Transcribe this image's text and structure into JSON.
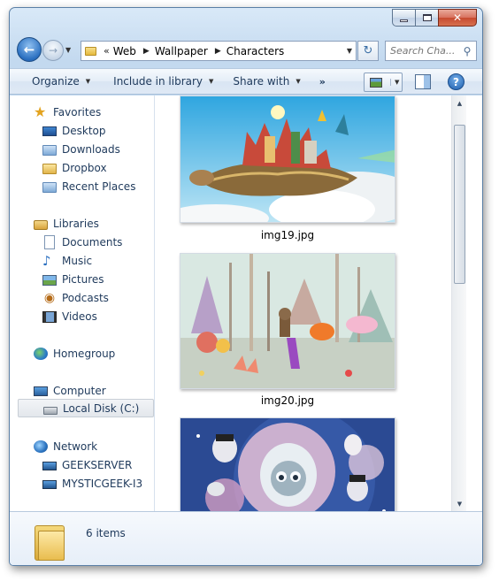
{
  "window": {
    "caption_buttons": {
      "minimize": "–",
      "maximize": "□",
      "close": "✕"
    }
  },
  "nav": {
    "back_glyph": "←",
    "forward_glyph": "→",
    "breadcrumbs": [
      "Web",
      "Wallpaper",
      "Characters"
    ],
    "overflow_chevron": "«",
    "search_placeholder": "Search Cha...",
    "refresh_glyph": "↻",
    "search_glyph": "⚲"
  },
  "commandbar": {
    "items": [
      {
        "label": "Organize",
        "dropdown": true
      },
      {
        "label": "Include in library",
        "dropdown": true
      },
      {
        "label": "Share with",
        "dropdown": true
      }
    ],
    "more": "»",
    "help": "?"
  },
  "sidebar": {
    "favorites": {
      "label": "Favorites",
      "icon": "star-icon",
      "items": [
        {
          "label": "Desktop",
          "icon": "desktop-icon"
        },
        {
          "label": "Downloads",
          "icon": "downloads-folder-icon"
        },
        {
          "label": "Dropbox",
          "icon": "dropbox-folder-icon"
        },
        {
          "label": "Recent Places",
          "icon": "recent-places-icon"
        }
      ]
    },
    "libraries": {
      "label": "Libraries",
      "icon": "library-icon",
      "items": [
        {
          "label": "Documents",
          "icon": "documents-icon"
        },
        {
          "label": "Music",
          "icon": "music-icon"
        },
        {
          "label": "Pictures",
          "icon": "pictures-icon"
        },
        {
          "label": "Podcasts",
          "icon": "podcasts-icon"
        },
        {
          "label": "Videos",
          "icon": "videos-icon"
        }
      ]
    },
    "homegroup": {
      "label": "Homegroup",
      "icon": "homegroup-icon"
    },
    "computer": {
      "label": "Computer",
      "icon": "computer-icon",
      "items": [
        {
          "label": "Local Disk (C:)",
          "icon": "local-disk-icon",
          "selected": true
        }
      ]
    },
    "network": {
      "label": "Network",
      "icon": "network-icon",
      "items": [
        {
          "label": "GEEKSERVER",
          "icon": "network-computer-icon"
        },
        {
          "label": "MYSTICGEEK-I3",
          "icon": "network-computer-icon"
        }
      ]
    }
  },
  "files": [
    {
      "name": "",
      "thumbnail": "turtle-island-artwork"
    },
    {
      "name": "img19.jpg",
      "thumbnail": "fantasy-forest-artwork"
    },
    {
      "name": "img20.jpg",
      "thumbnail": "space-characters-artwork"
    }
  ],
  "details": {
    "item_count": "6 items"
  },
  "colors": {
    "accent": "#1e395b",
    "frame": "#c3d9ef",
    "selection": "#e3e7ec"
  }
}
